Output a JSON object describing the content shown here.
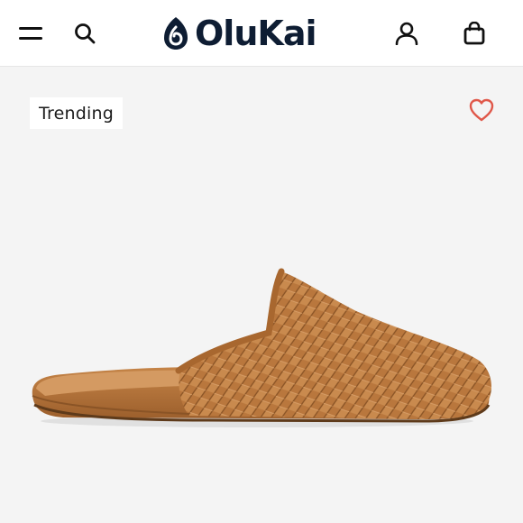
{
  "header": {
    "brand": "OluKai",
    "icons": {
      "menu": "hamburger-menu-icon",
      "search": "search-icon",
      "account": "account-icon",
      "bag": "shopping-bag-icon"
    }
  },
  "product_card": {
    "badge_label": "Trending",
    "favorite_icon": "heart-outline-icon",
    "image": "woven-leather-slipper"
  },
  "colors": {
    "header_bg": "#ffffff",
    "brand_navy": "#0e1d33",
    "page_bg": "#f4f4f4",
    "heart": "#e0584a",
    "leather": "#b9773d"
  }
}
